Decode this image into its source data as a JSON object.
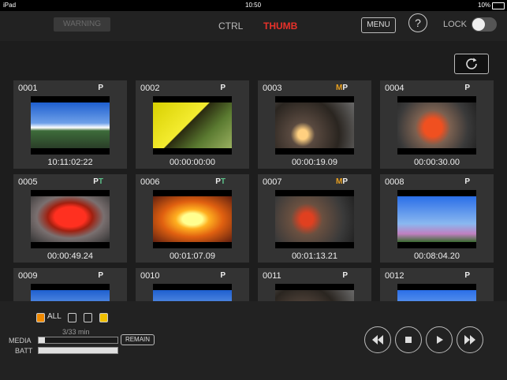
{
  "status": {
    "device": "iPad",
    "time": "10:50",
    "battery": "10%"
  },
  "topbar": {
    "warning_label": "WARNING",
    "tab_ctrl": "CTRL",
    "tab_thumb": "THUMB",
    "menu_label": "MENU",
    "help_label": "?",
    "lock_label": "LOCK"
  },
  "clips": [
    {
      "number": "0001",
      "m": "",
      "p": "P",
      "t": "",
      "timecode": "10:11:02:22",
      "scene": "sky"
    },
    {
      "number": "0002",
      "m": "",
      "p": "P",
      "t": "",
      "timecode": "00:00:00:00",
      "scene": "car"
    },
    {
      "number": "0003",
      "m": "M",
      "p": "P",
      "t": "",
      "timecode": "00:00:19.09",
      "scene": "glass"
    },
    {
      "number": "0004",
      "m": "",
      "p": "P",
      "t": "",
      "timecode": "00:00:30.00",
      "scene": "glass2"
    },
    {
      "number": "0005",
      "m": "",
      "p": "P",
      "t": "T",
      "timecode": "00:00:49.24",
      "scene": "red"
    },
    {
      "number": "0006",
      "m": "",
      "p": "P",
      "t": "T",
      "timecode": "00:01:07.09",
      "scene": "glow"
    },
    {
      "number": "0007",
      "m": "M",
      "p": "P",
      "t": "",
      "timecode": "00:01:13.21",
      "scene": "glass3"
    },
    {
      "number": "0008",
      "m": "",
      "p": "P",
      "t": "",
      "timecode": "00:08:04.20",
      "scene": "windmill"
    },
    {
      "number": "0009",
      "m": "",
      "p": "P",
      "t": "",
      "timecode": "",
      "scene": "sky"
    },
    {
      "number": "0010",
      "m": "",
      "p": "P",
      "t": "",
      "timecode": "",
      "scene": "sky"
    },
    {
      "number": "0011",
      "m": "",
      "p": "P",
      "t": "",
      "timecode": "",
      "scene": "glass"
    },
    {
      "number": "0012",
      "m": "",
      "p": "P",
      "t": "",
      "timecode": "",
      "scene": "windmill"
    }
  ],
  "bottom": {
    "all_label": "ALL",
    "remain_time": "3/33 min",
    "media_label": "MEDIA",
    "batt_label": "BATT",
    "remain_button": "REMAIN",
    "media_level": 0.08,
    "batt_level": 1.0
  },
  "colors": {
    "accent_red": "#e8312a",
    "flag_m": "#e8a020",
    "flag_t": "#5cc08a",
    "slot_orange": "#f08a00",
    "slot_yellow": "#f0c000"
  },
  "icons": [
    "refresh-icon",
    "rewind-icon",
    "stop-icon",
    "play-icon",
    "fast-forward-icon"
  ]
}
